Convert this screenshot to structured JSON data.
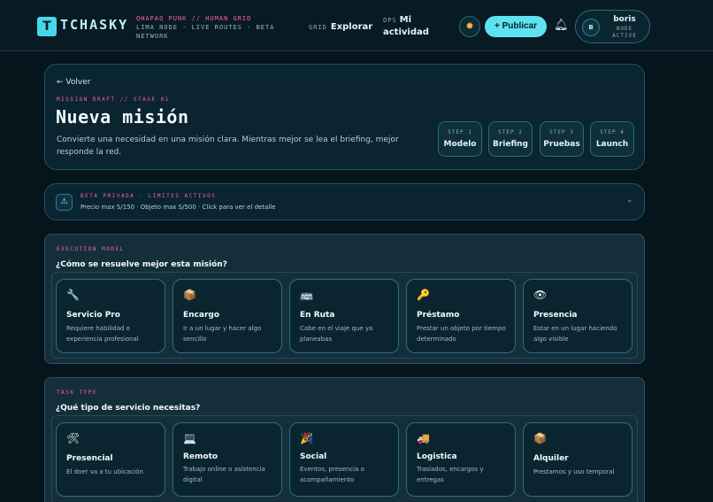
{
  "header": {
    "logo_letter": "T",
    "logo_text": "TCHASKY",
    "tagline_line1": "QHAPAQ PUNK // HUMAN GRID",
    "tagline_line2": "LIMA NODE · LIVE ROUTES · BETA",
    "tagline_line3": "NETWORK",
    "nav": [
      {
        "kicker": "GRID",
        "label": "Explorar"
      },
      {
        "kicker": "OPS",
        "label": "Mi actividad"
      }
    ],
    "theme_icon": "sun-icon",
    "publish_label": "+ Publicar",
    "bell_icon": "bell-icon",
    "user": {
      "initial": "B",
      "name": "boris",
      "role": "NODE ACTIVE"
    }
  },
  "hero": {
    "back_label": "← Volver",
    "kicker": "MISSION DRAFT // STAGE 01",
    "title": "Nueva misión",
    "description": "Convierte una necesidad en una misión clara. Mientras mejor se lea el briefing, mejor responde la red.",
    "steps": [
      {
        "kicker": "STEP 1",
        "label": "Modelo"
      },
      {
        "kicker": "STEP 2",
        "label": "Briefing"
      },
      {
        "kicker": "STEP 3",
        "label": "Pruebas"
      },
      {
        "kicker": "STEP 4",
        "label": "Launch"
      }
    ]
  },
  "beta": {
    "icon": "warning-icon",
    "title": "BETA PRIVADA · LIMITES ACTIVOS",
    "description": "Precio max S/150 · Objeto max S/500 · Click para ver el detalle",
    "chevron": "chevron-down-icon"
  },
  "execution_model": {
    "kicker": "EXECUTION MODEL",
    "question": "¿Cómo se resuelve mejor esta misión?",
    "options": [
      {
        "icon": "🔧",
        "title": "Servicio Pro",
        "desc": "Requiere habilidad o experiencia profesional"
      },
      {
        "icon": "📦",
        "title": "Encargo",
        "desc": "Ir a un lugar y hacer algo sencillo"
      },
      {
        "icon": "🚌",
        "title": "En Ruta",
        "desc": "Cabe en el viaje que ya planeabas"
      },
      {
        "icon": "🔑",
        "title": "Préstamo",
        "desc": "Prestar un objeto por tiempo determinado"
      },
      {
        "icon": "👁",
        "title": "Presencia",
        "desc": "Estar en un lugar haciendo algo visible"
      }
    ]
  },
  "task_type": {
    "kicker": "TASK TYPE",
    "question": "¿Qué tipo de servicio necesitas?",
    "options": [
      {
        "icon": "🛠",
        "title": "Presencial",
        "desc": "El doer va a tu ubicación"
      },
      {
        "icon": "💻",
        "title": "Remoto",
        "desc": "Trabajo online o asistencia digital"
      },
      {
        "icon": "🎉",
        "title": "Social",
        "desc": "Eventos, presencia o acompañamiento"
      },
      {
        "icon": "🚚",
        "title": "Logistica",
        "desc": "Traslados, encargos y entregas"
      },
      {
        "icon": "📦",
        "title": "Alquiler",
        "desc": "Prestamos y uso temporal"
      }
    ]
  }
}
